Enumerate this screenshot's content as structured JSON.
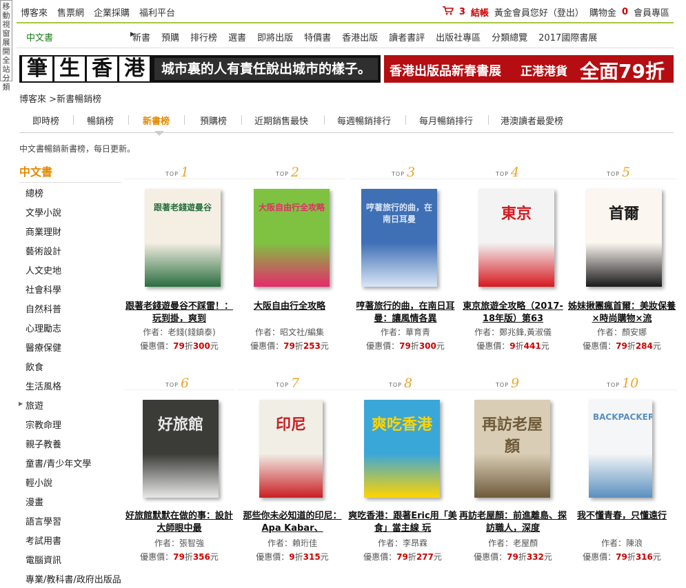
{
  "side_tab": "移動視窗展開全站分類",
  "topbar": {
    "links": [
      "博客來",
      "售票網",
      "企業採購",
      "福利平台"
    ],
    "cart_count": "3",
    "checkout": "結帳",
    "greeting": "黃金會員您好（登出）",
    "shopping_gold_label": "購物金",
    "shopping_gold_value": "0",
    "member_area": "會員專區"
  },
  "nav": {
    "current": "中文書",
    "items": [
      "新書",
      "預購",
      "排行榜",
      "選書",
      "即將出版",
      "特價書",
      "香港出版",
      "讀者書評",
      "出版社專區",
      "分類總覽",
      "2017國際書展"
    ]
  },
  "banners": {
    "left_logo": [
      "筆",
      "生",
      "香",
      "港"
    ],
    "left_text": "城市裏的人有責任說出城市的樣子。",
    "right_a": "香港出版品新春書展",
    "right_b": "正港港貨",
    "right_c": "全面79折"
  },
  "breadcrumb": {
    "home": "博客來",
    "sep": ">",
    "current": "新書暢銷榜"
  },
  "tabs": [
    "即時榜",
    "暢銷榜",
    "新書榜",
    "預購榜",
    "近期銷售最快",
    "每週暢銷排行",
    "每月暢銷排行",
    "港澳讀者最愛榜"
  ],
  "description": "中文書暢銷新書榜，每日更新。",
  "sidebar": {
    "heading": "中文書",
    "items": [
      "總榜",
      "文學小說",
      "商業理財",
      "藝術設計",
      "人文史地",
      "社會科學",
      "自然科普",
      "心理勵志",
      "醫療保健",
      "飲食",
      "生活風格",
      "旅遊",
      "宗教命理",
      "親子教養",
      "童書/青少年文學",
      "輕小說",
      "漫畫",
      "語言學習",
      "考試用書",
      "電腦資訊",
      "專業/教科書/政府出版品"
    ]
  },
  "labels": {
    "top": "TOP",
    "author": "作者：",
    "price": "優惠價：",
    "discount_unit": "折",
    "currency": "元"
  },
  "books": [
    {
      "rank": "1",
      "title": "跟著老錢遊曼谷不踩雷！：玩到掛，爽到",
      "author": "老錢(錢鎮泰)",
      "discount": "79",
      "price": "300",
      "cover_title": "跟著老錢遊曼谷",
      "cover_color": "#f4efe2",
      "cover_accent": "#2a6e3f"
    },
    {
      "rank": "2",
      "title": "大阪自由行全攻略",
      "author": "昭文社/編集",
      "discount": "79",
      "price": "253",
      "cover_title": "大阪自由行全攻略",
      "cover_color": "#7fc241",
      "cover_accent": "#e62a6b"
    },
    {
      "rank": "3",
      "title": "哼著旅行的曲，在南日耳曼：讓風情各異",
      "author": "華育青",
      "discount": "79",
      "price": "300",
      "cover_title": "哼著旅行的曲，在南日耳曼",
      "cover_color": "#3f6fb5",
      "cover_accent": "#d9e6f5"
    },
    {
      "rank": "4",
      "title": "東京旅遊全攻略（2017-18年版）第63",
      "author": "鄭兆鋒,黃淑儀",
      "discount": "9",
      "price": "441",
      "cover_title": "東京",
      "cover_color": "#f3f3f3",
      "cover_accent": "#d6191f"
    },
    {
      "rank": "5",
      "title": "姊妹揪團瘋首爾：美妝保養×時尚購物×流",
      "author": "顏安娜",
      "discount": "79",
      "price": "284",
      "cover_title": "首爾",
      "cover_color": "#fbf6f0",
      "cover_accent": "#1a1a1a"
    },
    {
      "rank": "6",
      "title": "好旅館默默在做的事：設計大師眼中最",
      "author": "張智強",
      "discount": "79",
      "price": "356",
      "cover_title": "好旅館",
      "cover_color": "#3b3b38",
      "cover_accent": "#e8e8e8"
    },
    {
      "rank": "7",
      "title": "那些你未必知道的印尼：Apa Kabar、",
      "author": "賴珩佳",
      "discount": "9",
      "price": "315",
      "cover_title": "印尼",
      "cover_color": "#f1eee6",
      "cover_accent": "#c91f24"
    },
    {
      "rank": "8",
      "title": "爽吃香港：跟著Eric用「美食」當主線 玩",
      "author": "李昂霖",
      "discount": "79",
      "price": "277",
      "cover_title": "爽吃香港",
      "cover_color": "#3aa7d9",
      "cover_accent": "#ffd400"
    },
    {
      "rank": "9",
      "title": "再訪老屋顏：前進離島、探訪職人，深度",
      "author": "老屋顏",
      "discount": "79",
      "price": "332",
      "cover_title": "再訪老屋顏",
      "cover_color": "#d9cdb5",
      "cover_accent": "#6f5a3a"
    },
    {
      "rank": "10",
      "title": "我不懂青春，只懂遠行",
      "author": "陳浪",
      "discount": "79",
      "price": "316",
      "cover_title": "BACKPACKER",
      "cover_color": "#f4f6f7",
      "cover_accent": "#5a8fc0"
    }
  ]
}
